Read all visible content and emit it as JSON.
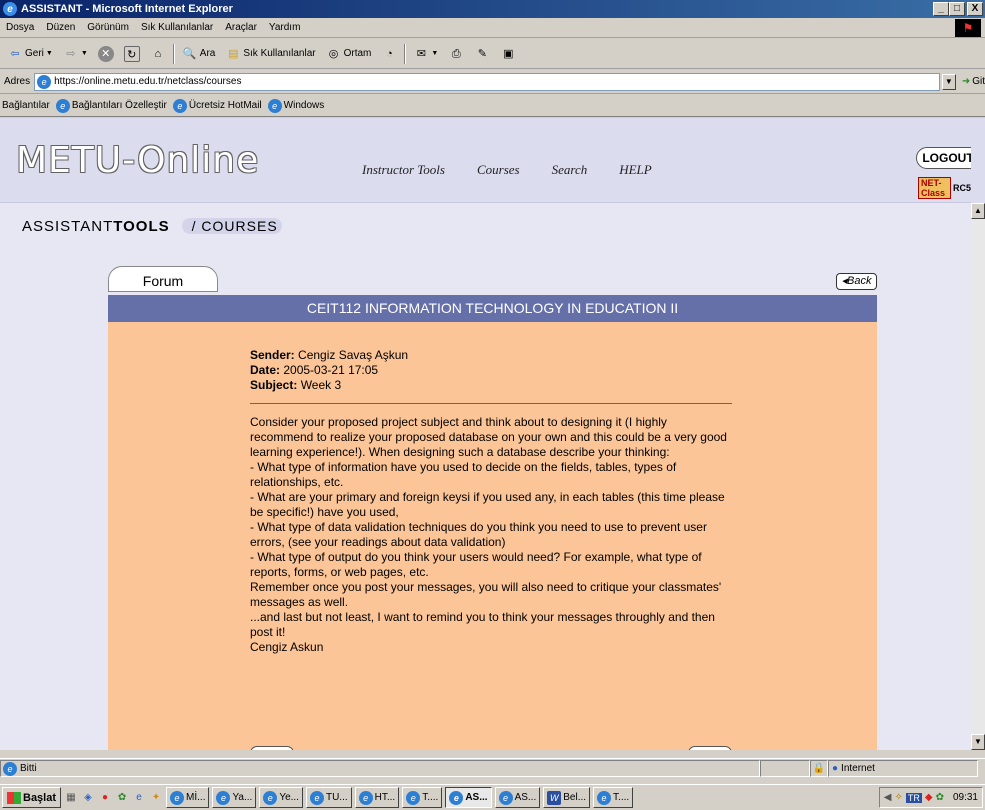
{
  "window": {
    "title": "ASSISTANT - Microsoft Internet Explorer",
    "min": "_",
    "max": "□",
    "close": "X"
  },
  "menu": [
    "Dosya",
    "Düzen",
    "Görünüm",
    "Sık Kullanılanlar",
    "Araçlar",
    "Yardım"
  ],
  "toolbar": {
    "back": "Geri",
    "search": "Ara",
    "favorites": "Sık Kullanılanlar",
    "media": "Ortam"
  },
  "address": {
    "label": "Adres",
    "url": "https://online.metu.edu.tr/netclass/courses",
    "go": "Git"
  },
  "links": {
    "label": "Bağlantılar",
    "items": [
      "Bağlantıları Özelleştir",
      "Ücretsiz HotMail",
      "Windows"
    ]
  },
  "site": {
    "logo": "METU-Online",
    "nav": [
      "Instructor Tools",
      "Courses",
      "Search",
      "HELP"
    ],
    "logout": "LOGOUT",
    "netclass": "NET-Class",
    "netclass_suffix": "RC5",
    "crumb_prefix": "ASSISTANT",
    "crumb_bold": "TOOLS",
    "crumb_current": "/ COURSES",
    "forum_tab": "Forum",
    "back": "Back",
    "course_title": "CEIT112 INFORMATION TECHNOLOGY IN EDUCATION II"
  },
  "message": {
    "sender_label": "Sender:",
    "sender": "Cengiz Savaş Aşkun",
    "date_label": "Date:",
    "date": "2005-03-21 17:05",
    "subject_label": "Subject:",
    "subject": "Week 3",
    "body": "Consider your proposed project subject and think about to designing it (I highly recommend to realize your proposed database on your own and this could be a very good learning experience!). When designing such a database describe your thinking:\n- What type of information have you used to decide on the fields, tables, types of relationships, etc.\n- What are your primary and foreign keysi if you used any, in each tables (this time please be specific!) have you used,\n- What type of data validation techniques do you think you need to use to prevent user errors, (see your readings about data validation)\n- What type of output do you think your users would need? For example, what type of reports, forms, or web pages, etc.\nRemember once you post your messages, you will also need to critique your classmates' messages as well.\n...and last but not least, I want to remind you to think your messages throughly and then post it!\nCengiz Askun"
  },
  "status": {
    "text": "Bitti",
    "zone": "Internet"
  },
  "taskbar": {
    "start": "Başlat",
    "tasks": [
      "Mİ...",
      "Ya...",
      "Ye...",
      "TU...",
      "HT...",
      "T....",
      "AS...",
      "AS...",
      "Bel...",
      "T...."
    ],
    "clock": "09:31",
    "lang": "TR"
  }
}
